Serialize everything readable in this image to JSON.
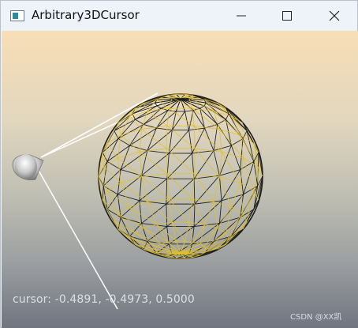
{
  "window": {
    "title": "Arbitrary3DCursor",
    "controls": {
      "minimize_icon": "minimize-icon",
      "maximize_icon": "maximize-icon",
      "close_icon": "close-icon"
    }
  },
  "viewport": {
    "background_top": "#f7deb6",
    "background_bottom": "#70757f",
    "cursor_readout": "cursor: -0.4891, -0.4973, 0.5000",
    "watermark": "CSDN @XX凯",
    "sphere_colors": {
      "black_wire": "#1d1d1d",
      "yellow_wire": "#e2c12a"
    }
  }
}
